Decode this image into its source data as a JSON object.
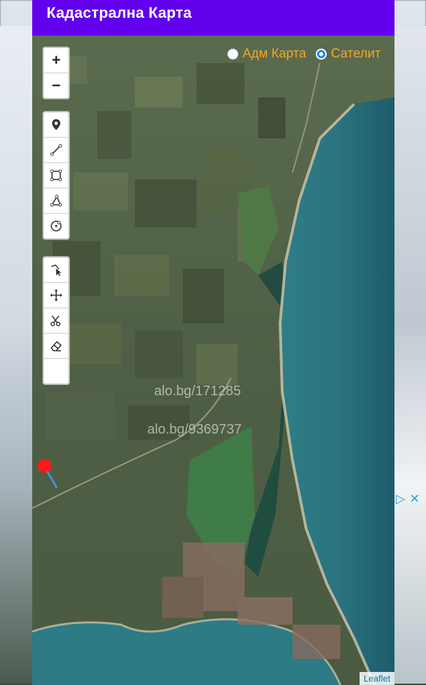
{
  "app": {
    "title": "Кадастрална Карта"
  },
  "layers": {
    "options": [
      {
        "label": "Адм Карта",
        "checked": false
      },
      {
        "label": "Сателит",
        "checked": true
      }
    ]
  },
  "controls": {
    "zoom_in": "+",
    "zoom_out": "−",
    "draw_tools": [
      "marker-icon",
      "polyline-icon",
      "rectangle-icon",
      "polygon-icon",
      "circle-marker-icon"
    ],
    "edit_tools": [
      "cursor-edit-icon",
      "move-icon",
      "cut-icon",
      "eraser-icon",
      "empty-slot"
    ]
  },
  "watermarks": [
    "alo.bg/171285",
    "alo.bg/9369737"
  ],
  "attribution": "Leaflet",
  "colors": {
    "header": "#6200ee",
    "radio_label": "#f5a623",
    "radio_selected": "#1e88e5"
  }
}
